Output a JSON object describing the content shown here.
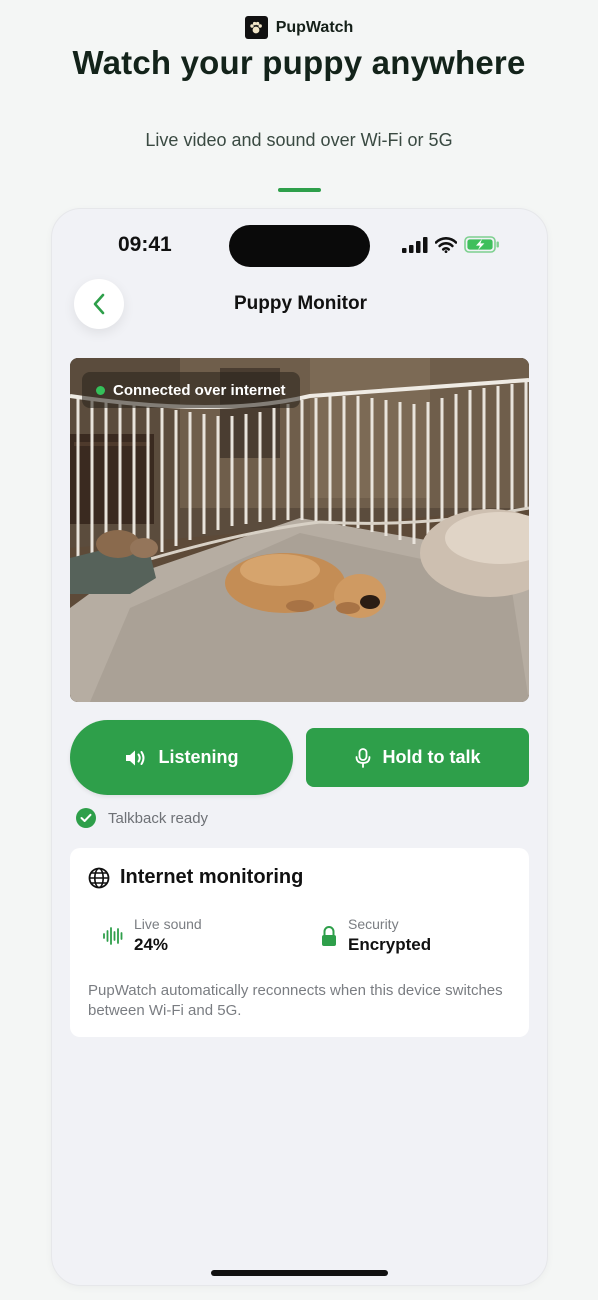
{
  "brand": {
    "name": "PupWatch",
    "logo_icon": "pawprint-logo-icon"
  },
  "hero": {
    "headline": "Watch your puppy anywhere",
    "subline": "Live video and sound over Wi-Fi or 5G"
  },
  "status_bar": {
    "time": "09:41",
    "icons": [
      "cellular-signal-icon",
      "wifi-icon",
      "battery-charging-icon"
    ]
  },
  "nav": {
    "title": "Puppy Monitor",
    "back_icon": "chevron-left-icon"
  },
  "camera": {
    "badge": "Connected over internet",
    "status_color": "#35c05a"
  },
  "controls": {
    "listen_label": "Listening",
    "listen_icon": "speaker-icon",
    "talk_label": "Hold to talk",
    "talk_icon": "microphone-icon"
  },
  "talkback": {
    "text": "Talkback ready"
  },
  "card": {
    "title": "Internet monitoring",
    "title_icon": "globe-icon",
    "stats": [
      {
        "label": "Live sound",
        "value": "24%",
        "icon": "sound-wave-icon"
      },
      {
        "label": "Security",
        "value": "Encrypted",
        "icon": "lock-icon"
      }
    ],
    "note": "PupWatch automatically reconnects when this device switches between Wi-Fi and 5G."
  },
  "colors": {
    "accent": "#2e9f4a",
    "background": "#f4f6f5",
    "phone_bg": "#f1f2f6"
  }
}
